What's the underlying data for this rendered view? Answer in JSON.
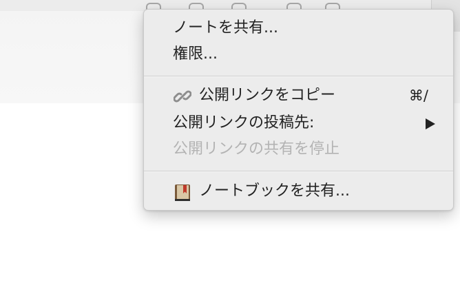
{
  "menu": {
    "items": [
      {
        "label": "ノートを共有..."
      },
      {
        "label": "権限..."
      },
      {
        "label": "公開リンクをコピー",
        "shortcut": "⌘/",
        "icon": "link-icon"
      },
      {
        "label": "公開リンクの投稿先:",
        "submenu": true
      },
      {
        "label": "公開リンクの共有を停止",
        "disabled": true
      },
      {
        "label": "ノートブックを共有...",
        "icon": "notebook-icon"
      }
    ]
  },
  "colors": {
    "menu_bg": "#ececec",
    "text": "#222222",
    "disabled_text": "#b3b3b3",
    "notebook_brown": "#7a5a3a",
    "link_gray": "#8d8d8d"
  }
}
